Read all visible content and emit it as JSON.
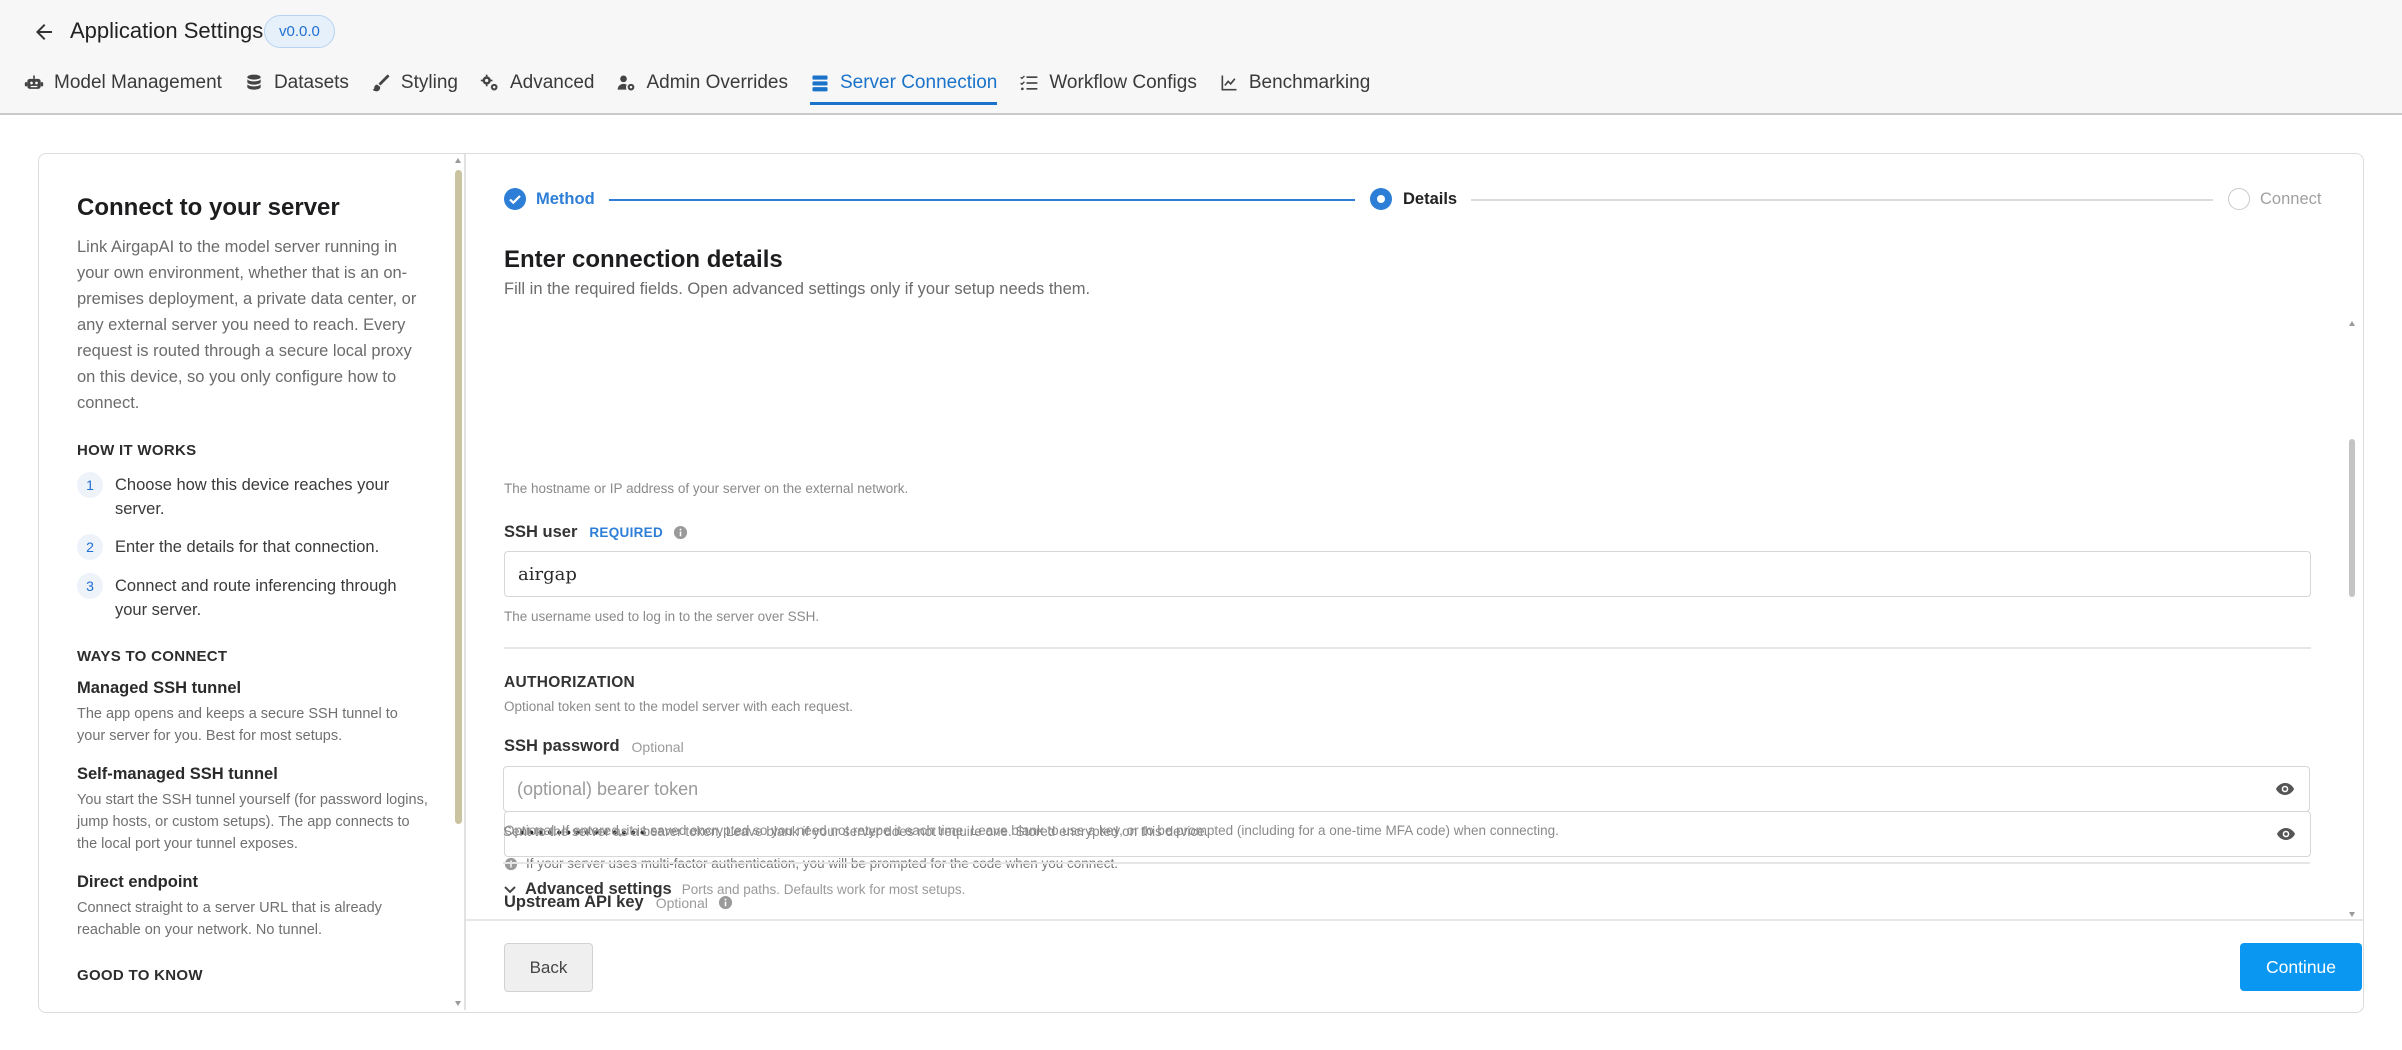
{
  "header": {
    "title": "Application Settings",
    "version": "v0.0.0"
  },
  "tabs": [
    {
      "label": "Model Management",
      "icon": "robot-icon",
      "active": false
    },
    {
      "label": "Datasets",
      "icon": "database-icon",
      "active": false
    },
    {
      "label": "Styling",
      "icon": "brush-icon",
      "active": false
    },
    {
      "label": "Advanced",
      "icon": "gears-icon",
      "active": false
    },
    {
      "label": "Admin Overrides",
      "icon": "user-cog-icon",
      "active": false
    },
    {
      "label": "Server Connection",
      "icon": "server-icon",
      "active": true
    },
    {
      "label": "Workflow Configs",
      "icon": "list-check-icon",
      "active": false
    },
    {
      "label": "Benchmarking",
      "icon": "chart-line-icon",
      "active": false
    }
  ],
  "sidebar": {
    "title": "Connect to your server",
    "intro": "Link AirgapAI to the model server running in your own environment, whether that is an on-premises deployment, a private data center, or any external server you need to reach. Every request is routed through a secure local proxy on this device, so you only configure how to connect.",
    "how_heading": "HOW IT WORKS",
    "steps": [
      {
        "num": "1",
        "text": "Choose how this device reaches your server."
      },
      {
        "num": "2",
        "text": "Enter the details for that connection."
      },
      {
        "num": "3",
        "text": "Connect and route inferencing through your server."
      }
    ],
    "ways_heading": "WAYS TO CONNECT",
    "ways": [
      {
        "title": "Managed SSH tunnel",
        "desc": "The app opens and keeps a secure SSH tunnel to your server for you. Best for most setups."
      },
      {
        "title": "Self-managed SSH tunnel",
        "desc": "You start the SSH tunnel yourself (for password logins, jump hosts, or custom setups). The app connects to the local port your tunnel exposes."
      },
      {
        "title": "Direct endpoint",
        "desc": "Connect straight to a server URL that is already reachable on your network. No tunnel."
      }
    ],
    "good_heading": "GOOD TO KNOW"
  },
  "stepper": {
    "steps": [
      {
        "label": "Method",
        "state": "done"
      },
      {
        "label": "Details",
        "state": "active"
      },
      {
        "label": "Connect",
        "state": "upcoming"
      }
    ]
  },
  "form": {
    "title": "Enter connection details",
    "subtitle": "Fill in the required fields. Open advanced settings only if your setup needs them.",
    "host_help": "The hostname or IP address of your server on the external network.",
    "ssh_user": {
      "label": "SSH user",
      "required": "REQUIRED",
      "value": "airgap",
      "help": "The username used to log in to the server over SSH."
    },
    "auth": {
      "heading": "AUTHORIZATION",
      "sub": "Optional token sent to the model server with each request."
    },
    "ssh_password": {
      "label": "SSH password",
      "optional": "Optional",
      "value": "••••••••••••••",
      "help": "Optional. If entered, it is saved encrypted so you need not retype it each time. Leave blank to use a key, or to be prompted (including for a one-time MFA code) when connecting.",
      "mfa_note": "If your server uses multi-factor authentication, you will be prompted for the code when you connect."
    },
    "api_key": {
      "label": "Upstream API key",
      "optional": "Optional",
      "placeholder": "(optional) bearer token",
      "help": "Sent to the server as a bearer token. Leave blank if your server does not require one. Stored encrypted on this device."
    },
    "advanced": {
      "label": "Advanced settings",
      "desc": "Ports and paths. Defaults work for most setups."
    }
  },
  "footer": {
    "back": "Back",
    "continue": "Continue"
  },
  "colors": {
    "accent": "#1a73c9",
    "primary_button": "#0a97f2"
  }
}
